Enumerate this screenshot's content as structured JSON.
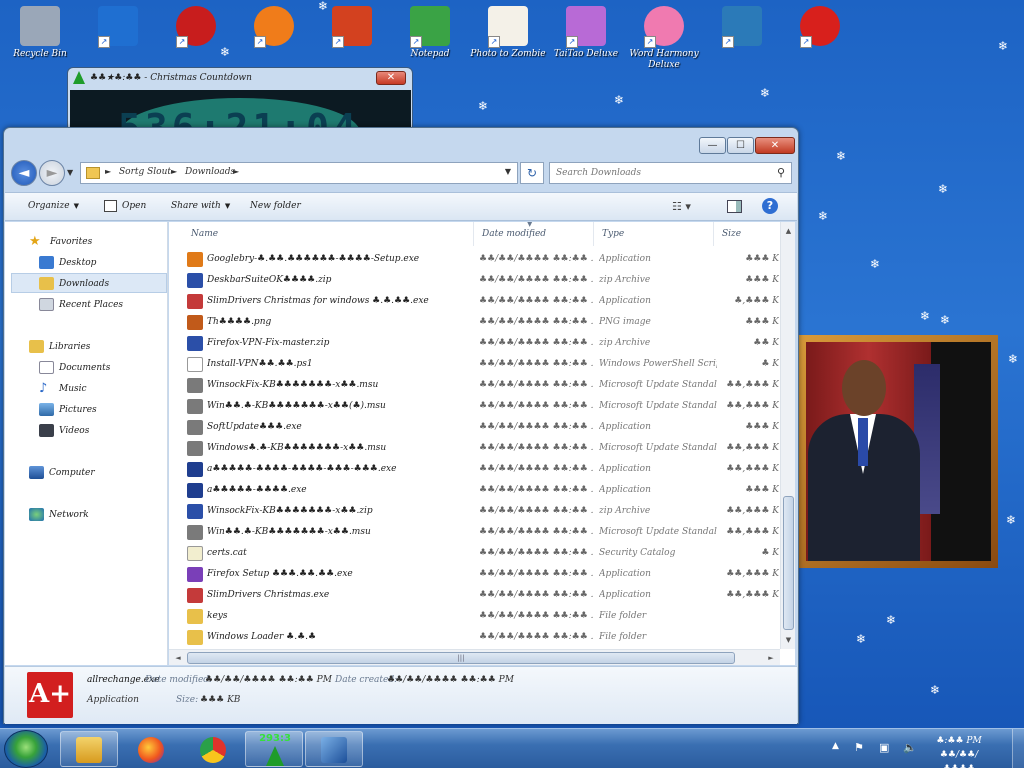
{
  "desktop": {
    "icons": [
      {
        "label": "Recycle Bin",
        "color": "#9aa7b8"
      },
      {
        "label": "",
        "color": "#1f6fd1"
      },
      {
        "label": "",
        "color": "#c81d1d"
      },
      {
        "label": "",
        "color": "#f07c1a"
      },
      {
        "label": "",
        "color": "#d3411f"
      },
      {
        "label": "Notepad",
        "color": "#3aa345"
      },
      {
        "label": "Photo to Zombie",
        "color": "#f4f1e8"
      },
      {
        "label": "TaiTao Deluxe",
        "color": "#b86ad6"
      },
      {
        "label": "Word Harmony Deluxe",
        "color": "#f07ab0"
      },
      {
        "label": "",
        "color": "#2b7ab8"
      },
      {
        "label": "",
        "color": "#d8201c"
      }
    ]
  },
  "clock_widget": {
    "title": "♣♣★♣:♣♣ - Christmas Countdown",
    "digits": "536:21:04",
    "close": "✕"
  },
  "explorer": {
    "caption_buttons": {
      "minimize": "—",
      "maximize": "☐",
      "close": "✕"
    },
    "nav": {
      "back": "◄",
      "forward": "►",
      "recent": "▼",
      "refresh": "↻"
    },
    "breadcrumb": [
      "Sortg Slout",
      "Downloads"
    ],
    "search_placeholder": "Search Downloads",
    "toolbar": {
      "organize": "Organize",
      "open": "Open",
      "share_with": "Share with",
      "new_folder": "New folder"
    },
    "navpane": {
      "favorites": "Favorites",
      "desktop": "Desktop",
      "downloads": "Downloads",
      "recent_places": "Recent Places",
      "libraries": "Libraries",
      "documents": "Documents",
      "music": "Music",
      "pictures": "Pictures",
      "videos": "Videos",
      "computer": "Computer",
      "network": "Network"
    },
    "columns": {
      "name": "Name",
      "date": "Date modified",
      "type": "Type",
      "size": "Size"
    },
    "files": [
      {
        "name": "Googlebry-♣.♣♣.♣♣♣♣♣♣-♣♣♣♣-Setup.exe",
        "date": "♣♣/♣♣/♣♣♣♣ ♣♣:♣♣ ...",
        "type": "Application",
        "size": "♣♣♣ K",
        "icon": "#e07a18"
      },
      {
        "name": "DeskbarSuiteOK♣♣♣♣.zip",
        "date": "♣♣/♣♣/♣♣♣♣ ♣♣:♣♣ ...",
        "type": "zip Archive",
        "size": "♣♣♣ K",
        "icon": "#2b4fa8"
      },
      {
        "name": "SlimDrivers Christmas for windows ♣.♣.♣♣.exe",
        "date": "♣♣/♣♣/♣♣♣♣ ♣♣:♣♣ ...",
        "type": "Application",
        "size": "♣,♣♣♣ K",
        "icon": "#c43a3a"
      },
      {
        "name": "Th♣♣♣♣.png",
        "date": "♣♣/♣♣/♣♣♣♣ ♣♣:♣♣ ...",
        "type": "PNG image",
        "size": "♣♣♣ K",
        "icon": "#c15a1a"
      },
      {
        "name": "Firefox-VPN-Fix-master.zip",
        "date": "♣♣/♣♣/♣♣♣♣ ♣♣:♣♣ ...",
        "type": "zip Archive",
        "size": "♣♣ K",
        "icon": "#2b4fa8"
      },
      {
        "name": "Install-VPN♣♣.♣♣.ps1",
        "date": "♣♣/♣♣/♣♣♣♣ ♣♣:♣♣ ...",
        "type": "Windows PowerShell Script",
        "size": "♣ K",
        "icon": "#ffffff"
      },
      {
        "name": "WinsockFix-KB♣♣♣♣♣♣♣-x♣♣.msu",
        "date": "♣♣/♣♣/♣♣♣♣ ♣♣:♣♣ ...",
        "type": "Microsoft Update Standalone...",
        "size": "♣♣,♣♣♣ K",
        "icon": "#7a7a7a"
      },
      {
        "name": "Win♣♣.♣-KB♣♣♣♣♣♣♣-x♣♣(♣).msu",
        "date": "♣♣/♣♣/♣♣♣♣ ♣♣:♣♣ ...",
        "type": "Microsoft Update Standalone...",
        "size": "♣♣,♣♣♣ K",
        "icon": "#7a7a7a"
      },
      {
        "name": "SoftUpdate♣♣♣.exe",
        "date": "♣♣/♣♣/♣♣♣♣ ♣♣:♣♣ ...",
        "type": "Application",
        "size": "♣♣♣ K",
        "icon": "#7a7a7a"
      },
      {
        "name": "Windows♣.♣-KB♣♣♣♣♣♣♣-x♣♣.msu",
        "date": "♣♣/♣♣/♣♣♣♣ ♣♣:♣♣ ...",
        "type": "Microsoft Update Standalone...",
        "size": "♣♣,♣♣♣ K",
        "icon": "#7a7a7a"
      },
      {
        "name": "a♣♣♣♣♣-♣♣♣♣-♣♣♣♣-♣♣♣-♣♣♣.exe",
        "date": "♣♣/♣♣/♣♣♣♣ ♣♣:♣♣ ...",
        "type": "Application",
        "size": "♣♣,♣♣♣ K",
        "icon": "#1f3e8f"
      },
      {
        "name": "a♣♣♣♣♣-♣♣♣♣.exe",
        "date": "♣♣/♣♣/♣♣♣♣ ♣♣:♣♣ ...",
        "type": "Application",
        "size": "♣♣♣ K",
        "icon": "#1f3e8f"
      },
      {
        "name": "WinsockFix-KB♣♣♣♣♣♣♣-x♣♣.zip",
        "date": "♣♣/♣♣/♣♣♣♣ ♣♣:♣♣ ...",
        "type": "zip Archive",
        "size": "♣♣,♣♣♣ K",
        "icon": "#2b4fa8"
      },
      {
        "name": "Win♣♣.♣-KB♣♣♣♣♣♣♣-x♣♣.msu",
        "date": "♣♣/♣♣/♣♣♣♣ ♣♣:♣♣ ...",
        "type": "Microsoft Update Standalone...",
        "size": "♣♣,♣♣♣ K",
        "icon": "#7a7a7a"
      },
      {
        "name": "certs.cat",
        "date": "♣♣/♣♣/♣♣♣♣ ♣♣:♣♣ ...",
        "type": "Security Catalog",
        "size": "♣ K",
        "icon": "#f2eecf"
      },
      {
        "name": "Firefox Setup ♣♣♣.♣♣.♣♣.exe",
        "date": "♣♣/♣♣/♣♣♣♣ ♣♣:♣♣ ...",
        "type": "Application",
        "size": "♣♣,♣♣♣ K",
        "icon": "#7a3fb8"
      },
      {
        "name": "SlimDrivers Christmas.exe",
        "date": "♣♣/♣♣/♣♣♣♣ ♣♣:♣♣ ...",
        "type": "Application",
        "size": "♣♣,♣♣♣ K",
        "icon": "#c43a3a"
      },
      {
        "name": "keys",
        "date": "♣♣/♣♣/♣♣♣♣ ♣♣:♣♣ ...",
        "type": "File folder",
        "size": "",
        "icon": "#e8c04a"
      },
      {
        "name": "Windows Loader ♣.♣.♣",
        "date": "♣♣/♣♣/♣♣♣♣ ♣♣:♣♣ ...",
        "type": "File folder",
        "size": "",
        "icon": "#e8c04a"
      }
    ],
    "details": {
      "filename": "allrechange.exe",
      "type": "Application",
      "date_modified_label": "Date modified:",
      "date_modified": "♣♣/♣♣/♣♣♣♣ ♣♣:♣♣ PM",
      "date_created_label": "Date created:",
      "date_created": "♣♣/♣♣/♣♣♣♣ ♣♣:♣♣ PM",
      "size_label": "Size:",
      "size": "♣♣♣ KB",
      "icon_text": "A+"
    }
  },
  "taskbar": {
    "clock_task_text": "293:3",
    "time": "♣:♣♣ PM",
    "date": "♣♣/♣♣/♣♣♣♣"
  }
}
